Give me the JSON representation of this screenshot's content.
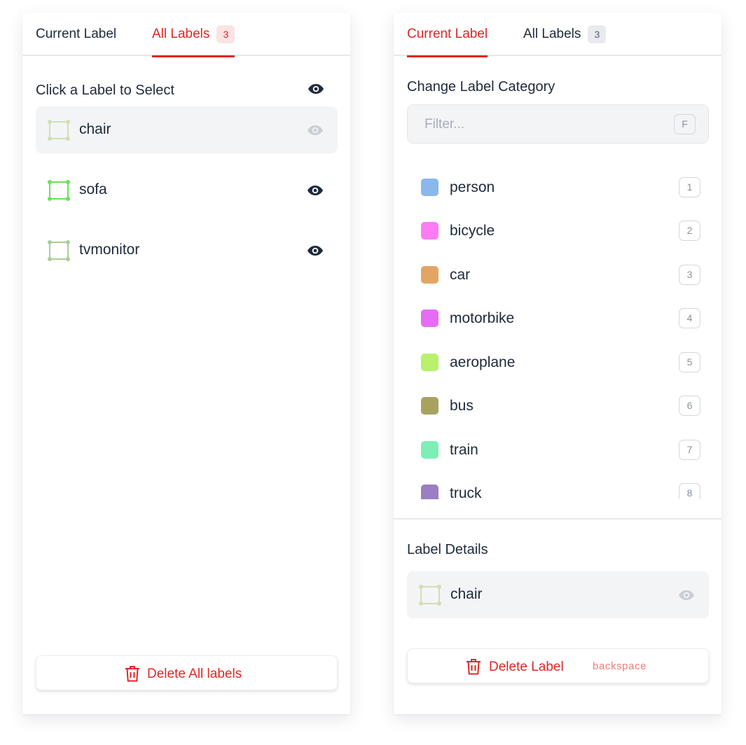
{
  "left_panel": {
    "tabs": [
      {
        "label": "Current Label",
        "active": false
      },
      {
        "label": "All Labels",
        "active": true,
        "badge": "3"
      }
    ],
    "section_title": "Click a Label to Select",
    "labels": [
      {
        "name": "chair",
        "selected": true,
        "visible": true,
        "color": "#cfe0b2",
        "icon": "bounding-box-icon"
      },
      {
        "name": "sofa",
        "selected": false,
        "visible": true,
        "color": "#6ee05a",
        "icon": "bounding-box-icon"
      },
      {
        "name": "tvmonitor",
        "selected": false,
        "visible": true,
        "color": "#a9cf99",
        "icon": "bounding-box-icon"
      }
    ],
    "delete_all_label": "Delete All labels"
  },
  "right_panel": {
    "tabs": [
      {
        "label": "Current Label",
        "active": true
      },
      {
        "label": "All Labels",
        "active": false,
        "badge": "3"
      }
    ],
    "category_title": "Change Label Category",
    "filter": {
      "placeholder": "Filter...",
      "value": "",
      "shortcut": "F"
    },
    "categories": [
      {
        "name": "person",
        "key": "1",
        "color": "#8ab8ec"
      },
      {
        "name": "bicycle",
        "key": "2",
        "color": "#ff7bf5"
      },
      {
        "name": "car",
        "key": "3",
        "color": "#e2a564"
      },
      {
        "name": "motorbike",
        "key": "4",
        "color": "#e56cf4"
      },
      {
        "name": "aeroplane",
        "key": "5",
        "color": "#b9f06c"
      },
      {
        "name": "bus",
        "key": "6",
        "color": "#a7a35f"
      },
      {
        "name": "train",
        "key": "7",
        "color": "#7deeb5"
      },
      {
        "name": "truck",
        "key": "8",
        "color": "#9c7ec2"
      }
    ],
    "details_title": "Label Details",
    "selected_label": {
      "name": "chair",
      "color": "#cfe0b2",
      "icon": "bounding-box-icon"
    },
    "delete_label": "Delete Label",
    "delete_hint": "backspace"
  },
  "colors": {
    "accent": "#e02626",
    "text": "#1e2a3b",
    "muted": "#a7aeb8"
  }
}
